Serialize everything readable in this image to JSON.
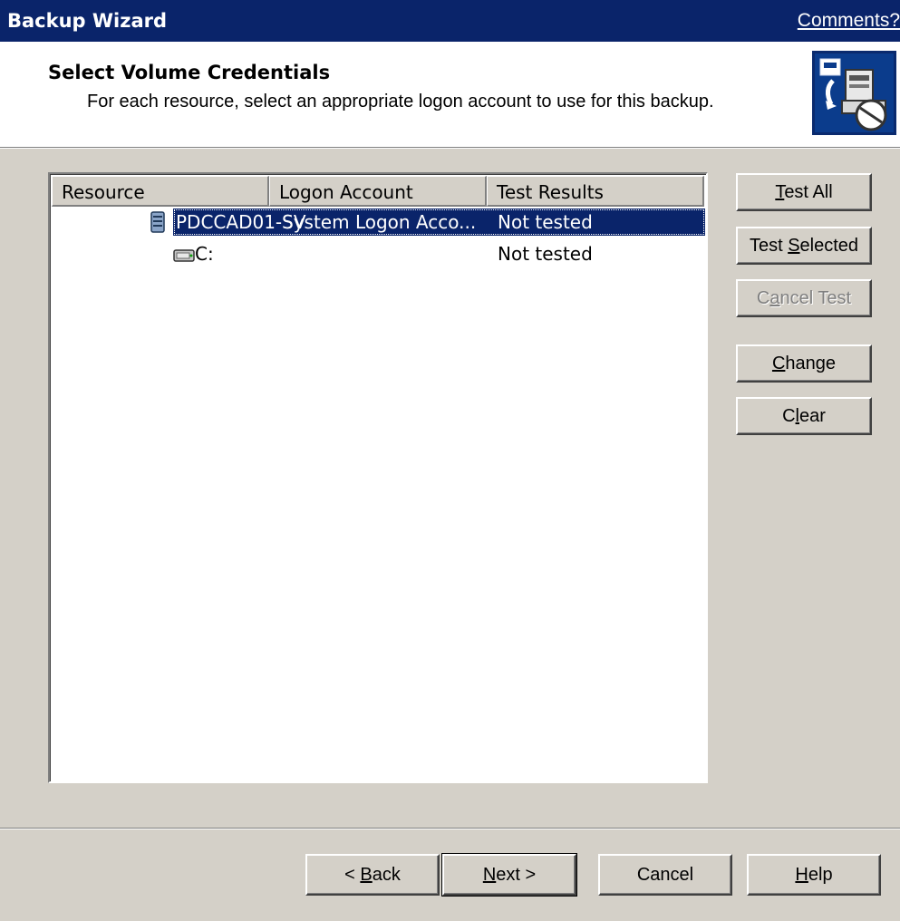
{
  "window": {
    "title": "Backup Wizard",
    "comments_link": "Comments?"
  },
  "header": {
    "heading": "Select Volume Credentials",
    "description": "For each resource, select an appropriate logon account to use for this backup.",
    "logo_icon": "backup-wizard-logo-icon"
  },
  "list": {
    "columns": [
      "Resource",
      "Logon Account",
      "Test Results"
    ],
    "rows": [
      {
        "resource": "PDCCAD01-SV",
        "logon_account": "System Logon Acco...",
        "test_result": "Not tested",
        "icon": "server-icon",
        "selected": true
      },
      {
        "resource": "C:",
        "logon_account": "",
        "test_result": "Not tested",
        "icon": "drive-icon",
        "selected": false
      }
    ]
  },
  "side_buttons": {
    "test_all": {
      "pre": "",
      "u": "T",
      "post": "est All"
    },
    "test_selected": {
      "pre": "Test ",
      "u": "S",
      "post": "elected"
    },
    "cancel_test": {
      "pre": "C",
      "u": "a",
      "post": "ncel Test"
    },
    "change": {
      "pre": "",
      "u": "C",
      "post": "hange"
    },
    "clear": {
      "pre": "C",
      "u": "l",
      "post": "ear"
    }
  },
  "footer_buttons": {
    "back": {
      "pre": "< ",
      "u": "B",
      "post": "ack"
    },
    "next": {
      "pre": "",
      "u": "N",
      "post": "ext >"
    },
    "cancel": "Cancel",
    "help": {
      "pre": "",
      "u": "H",
      "post": "elp"
    }
  },
  "colors": {
    "titlebar": "#0a246a",
    "selection": "#0a246a",
    "dialog": "#d4d0c8"
  }
}
